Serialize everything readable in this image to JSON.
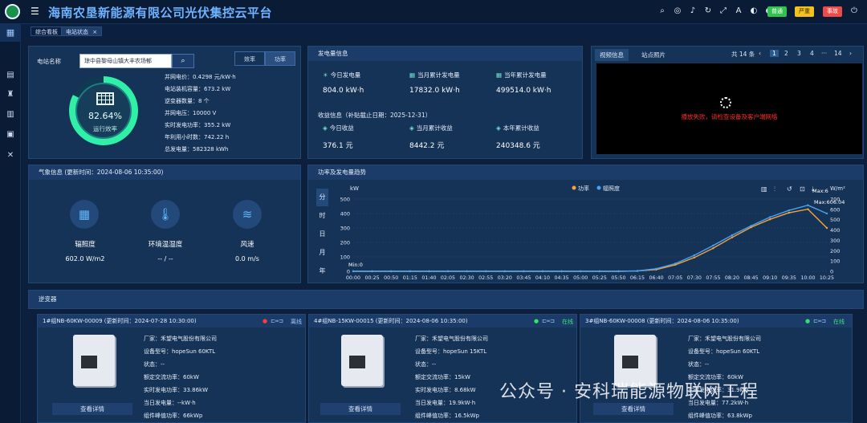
{
  "header": {
    "title": "海南农垦新能源有限公司光伏集控云平台",
    "badges": [
      "普通",
      "严重",
      "事故"
    ],
    "icons": [
      "search-icon",
      "globe-icon",
      "volume-icon",
      "refresh-icon",
      "fullscreen-icon",
      "translate-icon",
      "skin-icon",
      "user-icon",
      "exit-icon"
    ]
  },
  "tabs": [
    {
      "label": "综合看板"
    },
    {
      "label": "电站状态",
      "close": "×"
    }
  ],
  "station": {
    "label": "电站名称",
    "value": "琼中县黎母山镇大丰农场郁",
    "toggle": [
      "效率",
      "功率"
    ],
    "efficiency": "82.64%",
    "efficiency_label": "运行效率",
    "efficiency_fraction": 0.8264,
    "info": [
      "并网电价：0.4298 元/kW·h",
      "电站装机容量：673.2 kW",
      "逆变器数量：8 个",
      "并网电压：10000 V",
      "实时发电功率：355.2 kW",
      "年利用小时数：742.22 h",
      "总发电量：582328 kWh"
    ]
  },
  "generation": {
    "title": "发电量信息",
    "items": [
      {
        "label": "今日发电量",
        "value": "804.0 kW·h"
      },
      {
        "label": "当月累计发电量",
        "value": "17832.0 kW·h"
      },
      {
        "label": "当年累计发电量",
        "value": "499514.0 kW·h"
      }
    ],
    "income_title": "收益信息（补贴截止日期：2025-12-31）",
    "income": [
      {
        "label": "今日收益",
        "value": "376.1 元"
      },
      {
        "label": "当月累计收益",
        "value": "8442.2 元"
      },
      {
        "label": "本年累计收益",
        "value": "240348.6 元"
      }
    ]
  },
  "video": {
    "tabs": [
      "视频信息",
      "站点照片"
    ],
    "total": "共 14 条",
    "pages": [
      "1",
      "2",
      "3",
      "4",
      "···",
      "14"
    ],
    "error": "播放失败，请检查设备及客户端网络"
  },
  "weather": {
    "title": "气象信息 (更新时间：2024-08-06 10:35:00)",
    "items": [
      {
        "label": "辐照度",
        "value": "602.0 W/m2",
        "icon": "solar-panel-icon"
      },
      {
        "label": "环境温湿度",
        "value": "-- / --",
        "icon": "thermometer-icon"
      },
      {
        "label": "风速",
        "value": "0.0 m/s",
        "icon": "wind-icon"
      }
    ]
  },
  "trend": {
    "title": "功率及发电量趋势",
    "period_tabs": [
      "分",
      "时",
      "日",
      "月",
      "年"
    ],
    "legend": [
      "功率",
      "辐照度"
    ],
    "yleft_unit": "kW",
    "yright_unit": "W/m²",
    "min_label": "Min:0",
    "max_label": "Max:606.04",
    "max_label2": "Max:6",
    "tools": [
      "line-chart-icon",
      "bar-chart-icon",
      "restore-icon",
      "zoom-icon",
      "download-icon"
    ]
  },
  "chart_data": {
    "type": "line",
    "title": "功率及发电量趋势",
    "x": [
      "00:00",
      "00:25",
      "00:50",
      "01:15",
      "01:40",
      "02:05",
      "02:30",
      "02:55",
      "03:20",
      "03:45",
      "04:10",
      "04:35",
      "05:00",
      "05:25",
      "05:50",
      "06:15",
      "06:40",
      "07:05",
      "07:30",
      "07:55",
      "08:20",
      "08:45",
      "09:10",
      "09:35",
      "10:00",
      "10:25"
    ],
    "ylabel": "kW",
    "ylim": [
      0,
      500
    ],
    "y2label": "W/m²",
    "y2lim": [
      0,
      700
    ],
    "legend_position": "top",
    "series": [
      {
        "name": "功率",
        "axis": "left",
        "values": [
          0,
          0,
          0,
          0,
          0,
          0,
          0,
          0,
          0,
          0,
          0,
          0,
          0,
          0,
          0,
          2,
          12,
          45,
          95,
          160,
          235,
          305,
          360,
          405,
          430,
          300
        ]
      },
      {
        "name": "辐照度",
        "axis": "right",
        "values": [
          0,
          0,
          0,
          0,
          0,
          0,
          0,
          0,
          0,
          0,
          0,
          0,
          0,
          0,
          0,
          4,
          25,
          75,
          155,
          250,
          350,
          440,
          525,
          590,
          640,
          560
        ]
      }
    ]
  },
  "inverter": {
    "title": "逆变器",
    "cards": [
      {
        "name": "1#组NB-60KW-00009 (更新时间：2024-07-28 10:30:00)",
        "status": "离线",
        "dot": "#ff3c3c",
        "status_color": "#9cc6ff",
        "lines": [
          "厂家：禾望电气股份有限公司",
          "设备型号：hopeSun 60KTL",
          "状态：--",
          "额定交流功率：60kW",
          "实时发电功率：33.86kW",
          "当日发电量：--kW·h",
          "组件峰值功率：66kWp"
        ],
        "button": "查看详情"
      },
      {
        "name": "4#组NB-15KW-00015 (更新时间：2024-08-06 10:35:00)",
        "status": "在线",
        "dot": "#2ee46a",
        "status_color": "#3ee27a",
        "lines": [
          "厂家：禾望电气股份有限公司",
          "设备型号：hopeSun 15KTL",
          "状态：--",
          "额定交流功率：15kW",
          "实时发电功率：8.68kW",
          "当日发电量：19.9kW·h",
          "组件峰值功率：16.5kWp"
        ],
        "button": "查看详情"
      },
      {
        "name": "3#组NB-60KW-00008 (更新时间：2024-08-06 10:35:00)",
        "status": "在线",
        "dot": "#2ee46a",
        "status_color": "#3ee27a",
        "lines": [
          "厂家：禾望电气股份有限公司",
          "设备型号：hopeSun 60KTL",
          "状态：--",
          "额定交流功率：60kW",
          "实时发电功率：31.9kW",
          "当日发电量：77.2kW·h",
          "组件峰值功率：63.8kWp"
        ],
        "button": "查看详情"
      }
    ]
  },
  "watermark": "公众号 · 安科瑞能源物联网工程"
}
